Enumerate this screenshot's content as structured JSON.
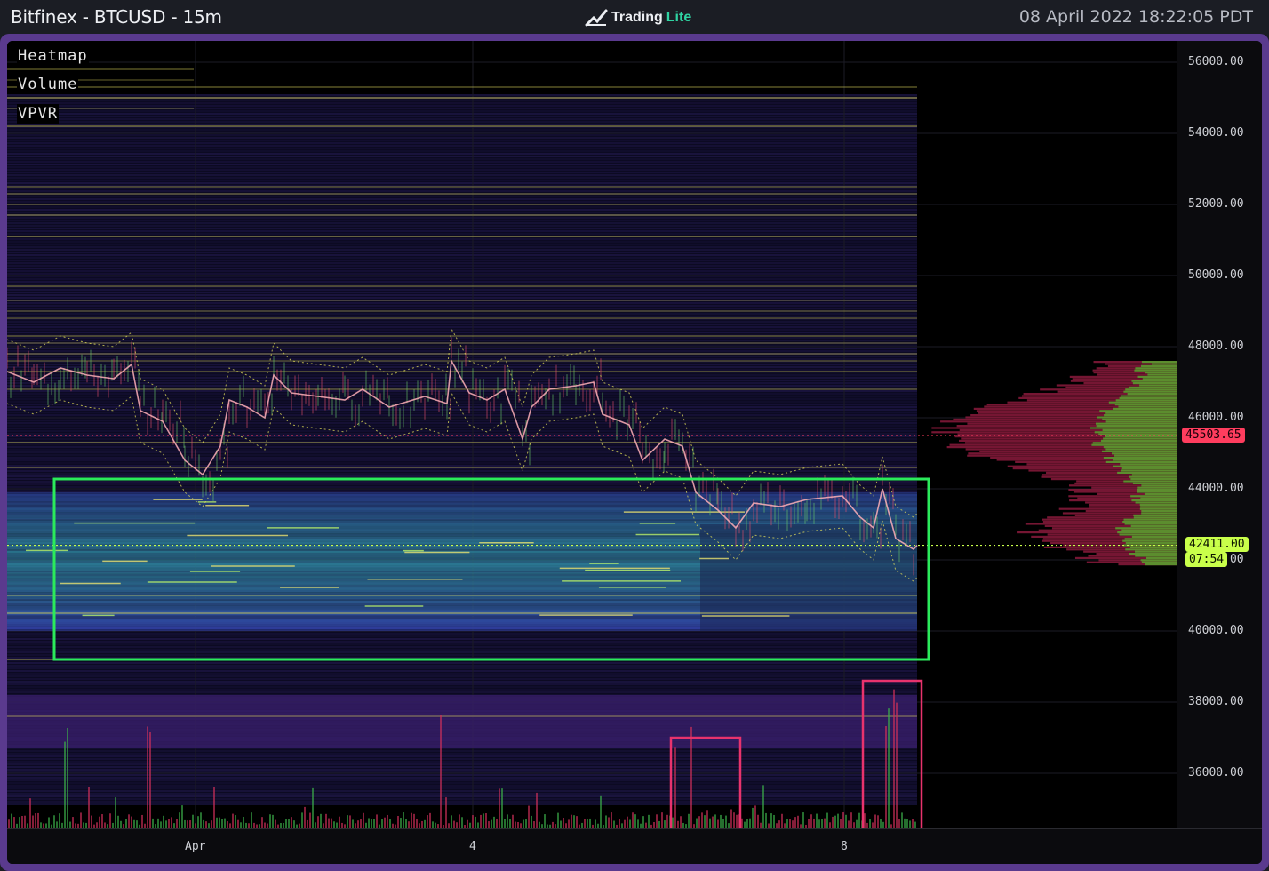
{
  "header": {
    "title": "Bitfinex - BTCUSD - 15m",
    "brand_main": "Trading",
    "brand_accent": "Lite",
    "timestamp": "08 April 2022 18:22:05 PDT"
  },
  "indicators": [
    "Heatmap",
    "Volume",
    "VPVR"
  ],
  "price_axis": {
    "ticks": [
      "56000.00",
      "54000.00",
      "52000.00",
      "50000.00",
      "48000.00",
      "46000.00",
      "44000.00",
      "42000.00",
      "40000.00",
      "38000.00",
      "36000.00"
    ]
  },
  "time_axis": {
    "ticks": [
      "Apr",
      "4",
      "8"
    ]
  },
  "price_tags": {
    "high_line": "45503.65",
    "current_price": "42411.00",
    "countdown": "07:54"
  },
  "colors": {
    "accent_green_box": "#2bea5b",
    "accent_red_box": "#e8336d",
    "frame": "#5a3a8e",
    "brand_accent": "#2fd3a2"
  },
  "chart_data": {
    "type": "heatmap",
    "title": "",
    "ylim": [
      34000,
      56500
    ],
    "y_ticks": [
      56000,
      54000,
      52000,
      50000,
      48000,
      46000,
      44000,
      42000,
      40000,
      38000,
      36000
    ],
    "x_ticks": [
      "Apr",
      "4",
      "8"
    ],
    "reference_lines": [
      {
        "value": 45503.65,
        "style": "dotted",
        "color": "#ff3d5e"
      },
      {
        "value": 42411.0,
        "style": "dotted",
        "color": "#c9ff4a"
      }
    ],
    "layers": [
      "Heatmap",
      "Volume",
      "VPVR"
    ]
  }
}
